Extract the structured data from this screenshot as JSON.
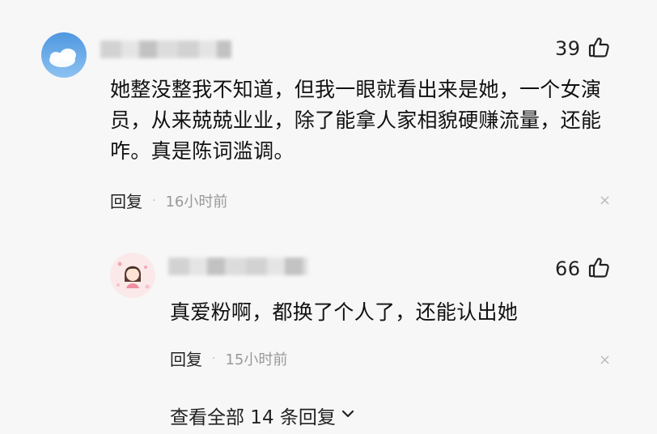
{
  "comment": {
    "likes": "39",
    "text": "她整没整我不知道，但我一眼就看出来是她，一个女演员，从来兢兢业业，除了能拿人家相貌硬赚流量，还能咋。真是陈词滥调。",
    "reply_label": "回复",
    "separator": "·",
    "time": "16小时前",
    "close": "×"
  },
  "reply": {
    "likes": "66",
    "text": "真爱粉啊，都换了个人了，还能认出她",
    "reply_label": "回复",
    "separator": "·",
    "time": "15小时前",
    "close": "×"
  },
  "view_all": {
    "label": "查看全部 14 条回复"
  },
  "icons": {
    "thumb": "thumbs-up-icon",
    "chevron": "chevron-down-icon"
  }
}
